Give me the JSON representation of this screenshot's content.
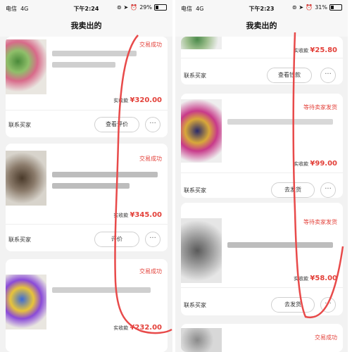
{
  "screens": [
    {
      "status_bar": {
        "carrier": "电信",
        "network": "4G",
        "time": "下午2:24",
        "battery": "29%",
        "battery_level": 0.29
      },
      "title": "我卖出的",
      "orders": [
        {
          "status": "交易成功",
          "price_prefix": "实收款",
          "price": "¥320.00",
          "contact": "联系买家",
          "action": "查看评价",
          "more": "···"
        },
        {
          "status": "交易成功",
          "price_prefix": "实收款",
          "price": "¥345.00",
          "contact": "联系买家",
          "action": "评价",
          "more": "···"
        },
        {
          "status": "交易成功",
          "price_prefix": "实收款",
          "price": "¥232.00"
        }
      ]
    },
    {
      "status_bar": {
        "carrier": "电信",
        "network": "4G",
        "time": "下午2:23",
        "battery": "31%",
        "battery_level": 0.31
      },
      "title": "我卖出的",
      "orders": [
        {
          "price_prefix": "实收款",
          "price": "¥25.80",
          "contact": "联系买家",
          "action": "查看钱款",
          "more": "···"
        },
        {
          "status": "等待卖家发货",
          "price_prefix": "实收款",
          "price": "¥99.00",
          "contact": "联系买家",
          "action": "去发货",
          "more": "···"
        },
        {
          "status": "等待卖家发货",
          "price_prefix": "实收款",
          "price": "¥58.00",
          "contact": "联系买家",
          "action": "去发货",
          "more": "···"
        },
        {
          "status": "交易成功"
        }
      ]
    }
  ],
  "colors": {
    "accent": "#e3413a",
    "background": "#f2f2f2",
    "card": "#ffffff",
    "annotation": "#e84a4a"
  }
}
